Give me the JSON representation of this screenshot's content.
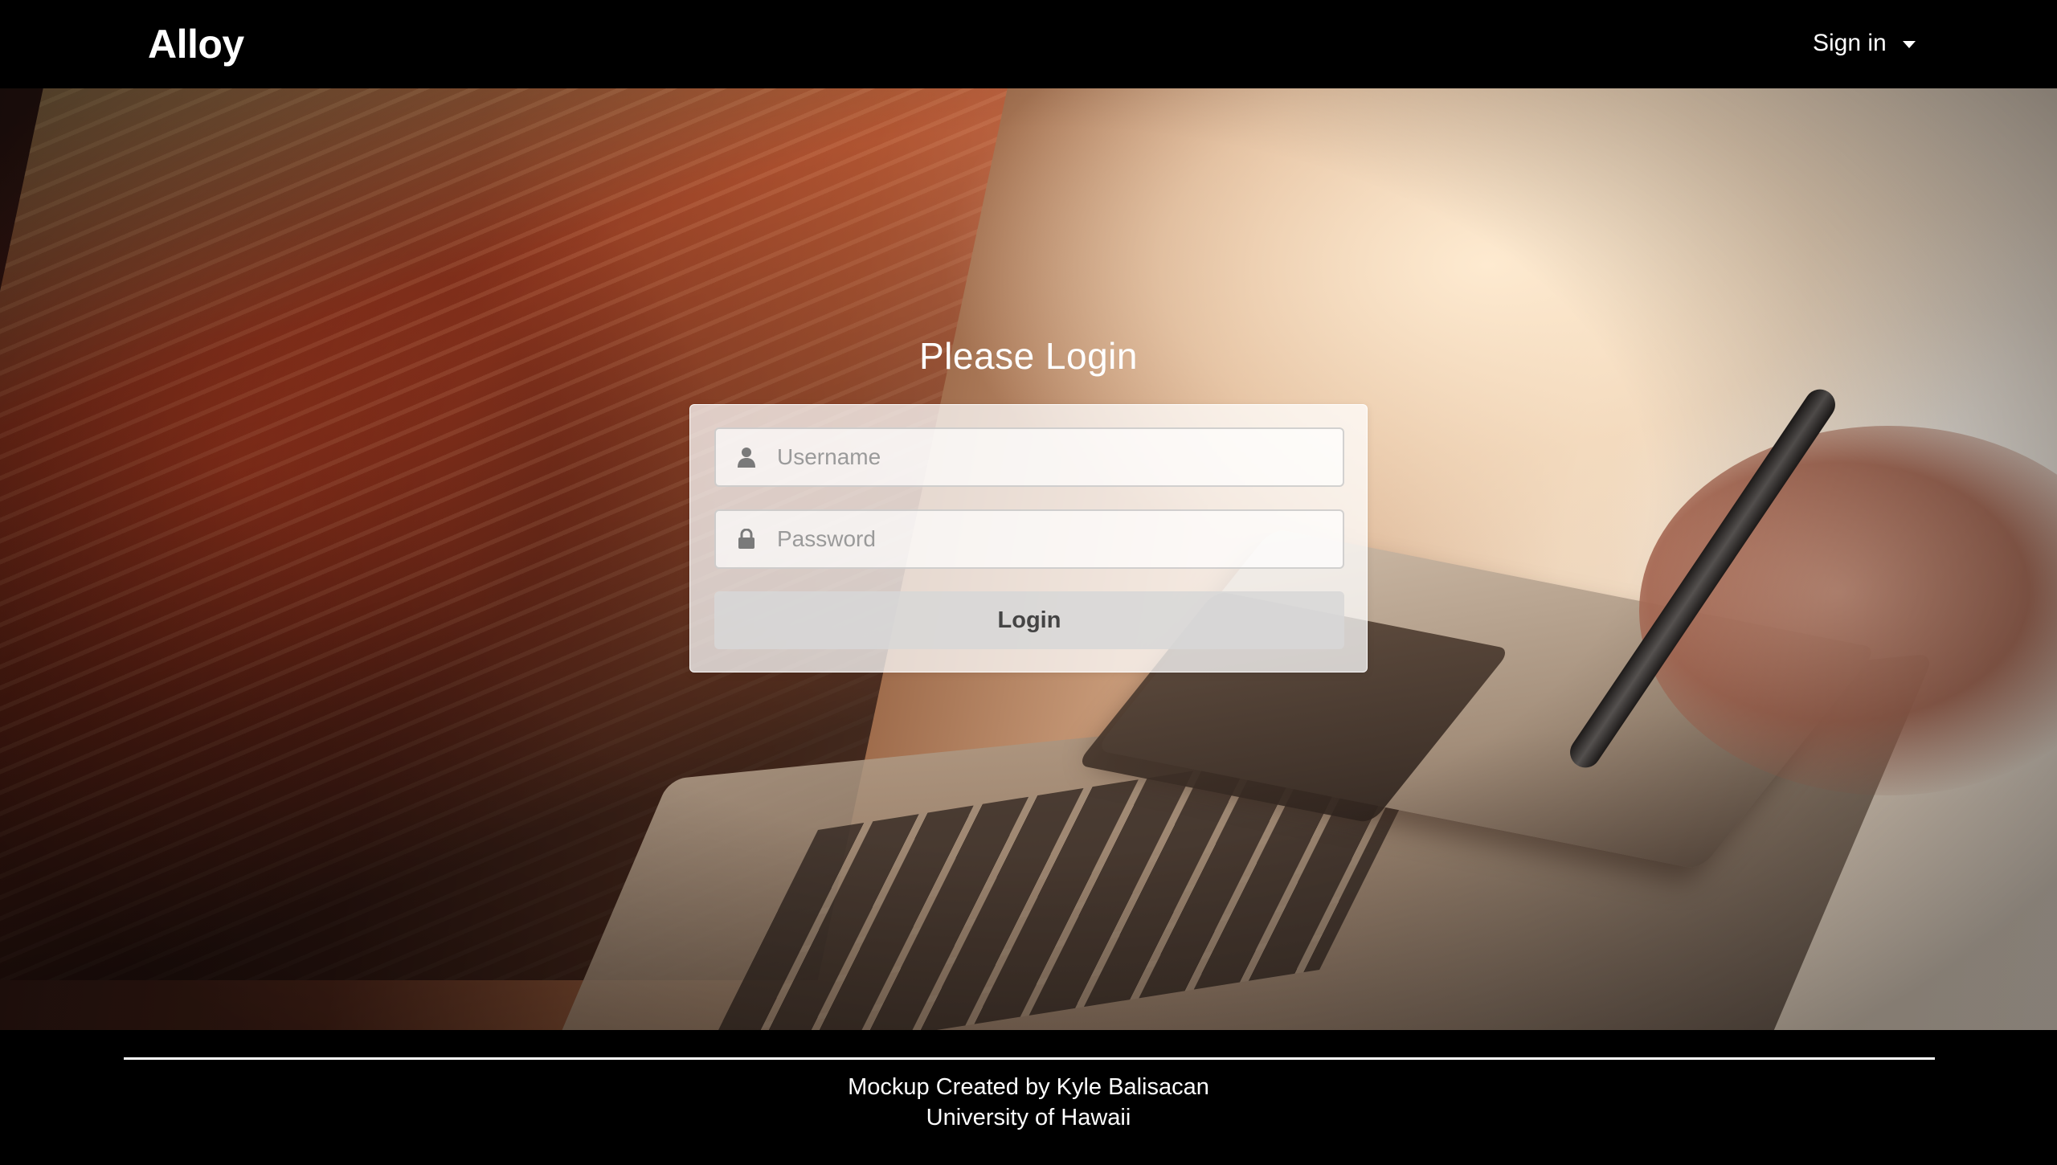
{
  "navbar": {
    "brand": "Alloy",
    "signin_label": "Sign in",
    "signin_icon": "caret-down-icon"
  },
  "login": {
    "title": "Please Login",
    "username_placeholder": "Username",
    "username_icon": "user-icon",
    "password_placeholder": "Password",
    "password_icon": "lock-icon",
    "submit_label": "Login"
  },
  "footer": {
    "line1": "Mockup Created by Kyle Balisacan",
    "line2": "University of Hawaii"
  },
  "colors": {
    "navbar_bg": "#000000",
    "footer_bg": "#000000",
    "text_light": "#ffffff",
    "button_bg": "#d7d7d7"
  }
}
